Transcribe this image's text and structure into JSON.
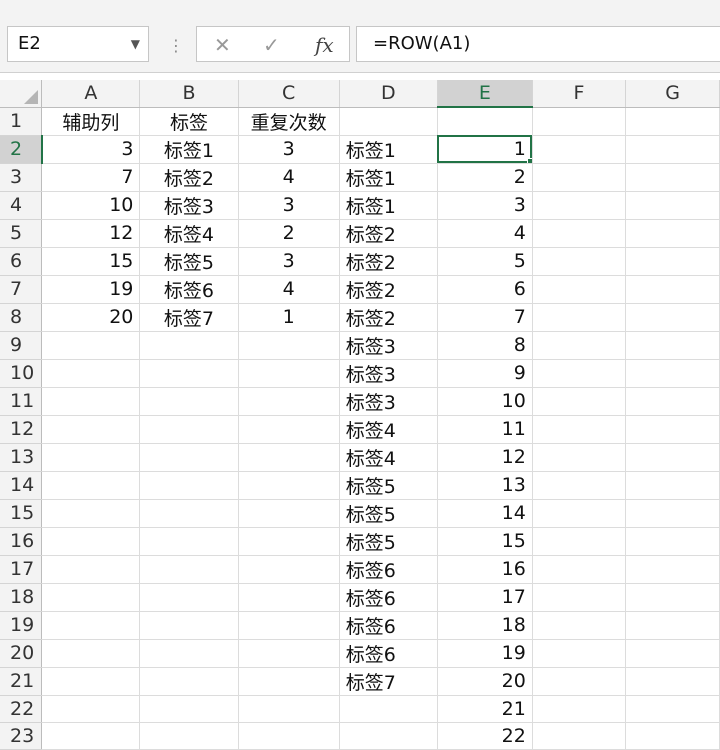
{
  "name_box": "E2",
  "formula": "=ROW(A1)",
  "columns": [
    "A",
    "B",
    "C",
    "D",
    "E",
    "F",
    "G"
  ],
  "selected_column": "E",
  "selected_row": 2,
  "rows": [
    {
      "n": "1",
      "A": "辅助列",
      "B": "标签",
      "C": "重复次数",
      "D": "",
      "E": ""
    },
    {
      "n": "2",
      "A": "3",
      "B": "标签1",
      "C": "3",
      "D": "标签1",
      "E": "1"
    },
    {
      "n": "3",
      "A": "7",
      "B": "标签2",
      "C": "4",
      "D": "标签1",
      "E": "2"
    },
    {
      "n": "4",
      "A": "10",
      "B": "标签3",
      "C": "3",
      "D": "标签1",
      "E": "3"
    },
    {
      "n": "5",
      "A": "12",
      "B": "标签4",
      "C": "2",
      "D": "标签2",
      "E": "4"
    },
    {
      "n": "6",
      "A": "15",
      "B": "标签5",
      "C": "3",
      "D": "标签2",
      "E": "5"
    },
    {
      "n": "7",
      "A": "19",
      "B": "标签6",
      "C": "4",
      "D": "标签2",
      "E": "6"
    },
    {
      "n": "8",
      "A": "20",
      "B": "标签7",
      "C": "1",
      "D": "标签2",
      "E": "7"
    },
    {
      "n": "9",
      "A": "",
      "B": "",
      "C": "",
      "D": "标签3",
      "E": "8"
    },
    {
      "n": "10",
      "A": "",
      "B": "",
      "C": "",
      "D": "标签3",
      "E": "9"
    },
    {
      "n": "11",
      "A": "",
      "B": "",
      "C": "",
      "D": "标签3",
      "E": "10"
    },
    {
      "n": "12",
      "A": "",
      "B": "",
      "C": "",
      "D": "标签4",
      "E": "11"
    },
    {
      "n": "13",
      "A": "",
      "B": "",
      "C": "",
      "D": "标签4",
      "E": "12"
    },
    {
      "n": "14",
      "A": "",
      "B": "",
      "C": "",
      "D": "标签5",
      "E": "13"
    },
    {
      "n": "15",
      "A": "",
      "B": "",
      "C": "",
      "D": "标签5",
      "E": "14"
    },
    {
      "n": "16",
      "A": "",
      "B": "",
      "C": "",
      "D": "标签5",
      "E": "15"
    },
    {
      "n": "17",
      "A": "",
      "B": "",
      "C": "",
      "D": "标签6",
      "E": "16"
    },
    {
      "n": "18",
      "A": "",
      "B": "",
      "C": "",
      "D": "标签6",
      "E": "17"
    },
    {
      "n": "19",
      "A": "",
      "B": "",
      "C": "",
      "D": "标签6",
      "E": "18"
    },
    {
      "n": "20",
      "A": "",
      "B": "",
      "C": "",
      "D": "标签6",
      "E": "19"
    },
    {
      "n": "21",
      "A": "",
      "B": "",
      "C": "",
      "D": "标签7",
      "E": "20"
    },
    {
      "n": "22",
      "A": "",
      "B": "",
      "C": "",
      "D": "",
      "E": "21"
    },
    {
      "n": "23",
      "A": "",
      "B": "",
      "C": "",
      "D": "",
      "E": "22"
    }
  ],
  "colors": {
    "accent": "#217346",
    "header_bg": "#f3f3f3",
    "selected_header_bg": "#d2d2d2"
  },
  "icons": {
    "cancel": "close-icon",
    "enter": "check-icon",
    "function": "fx-icon",
    "name_box_dropdown": "chevron-down-icon"
  }
}
